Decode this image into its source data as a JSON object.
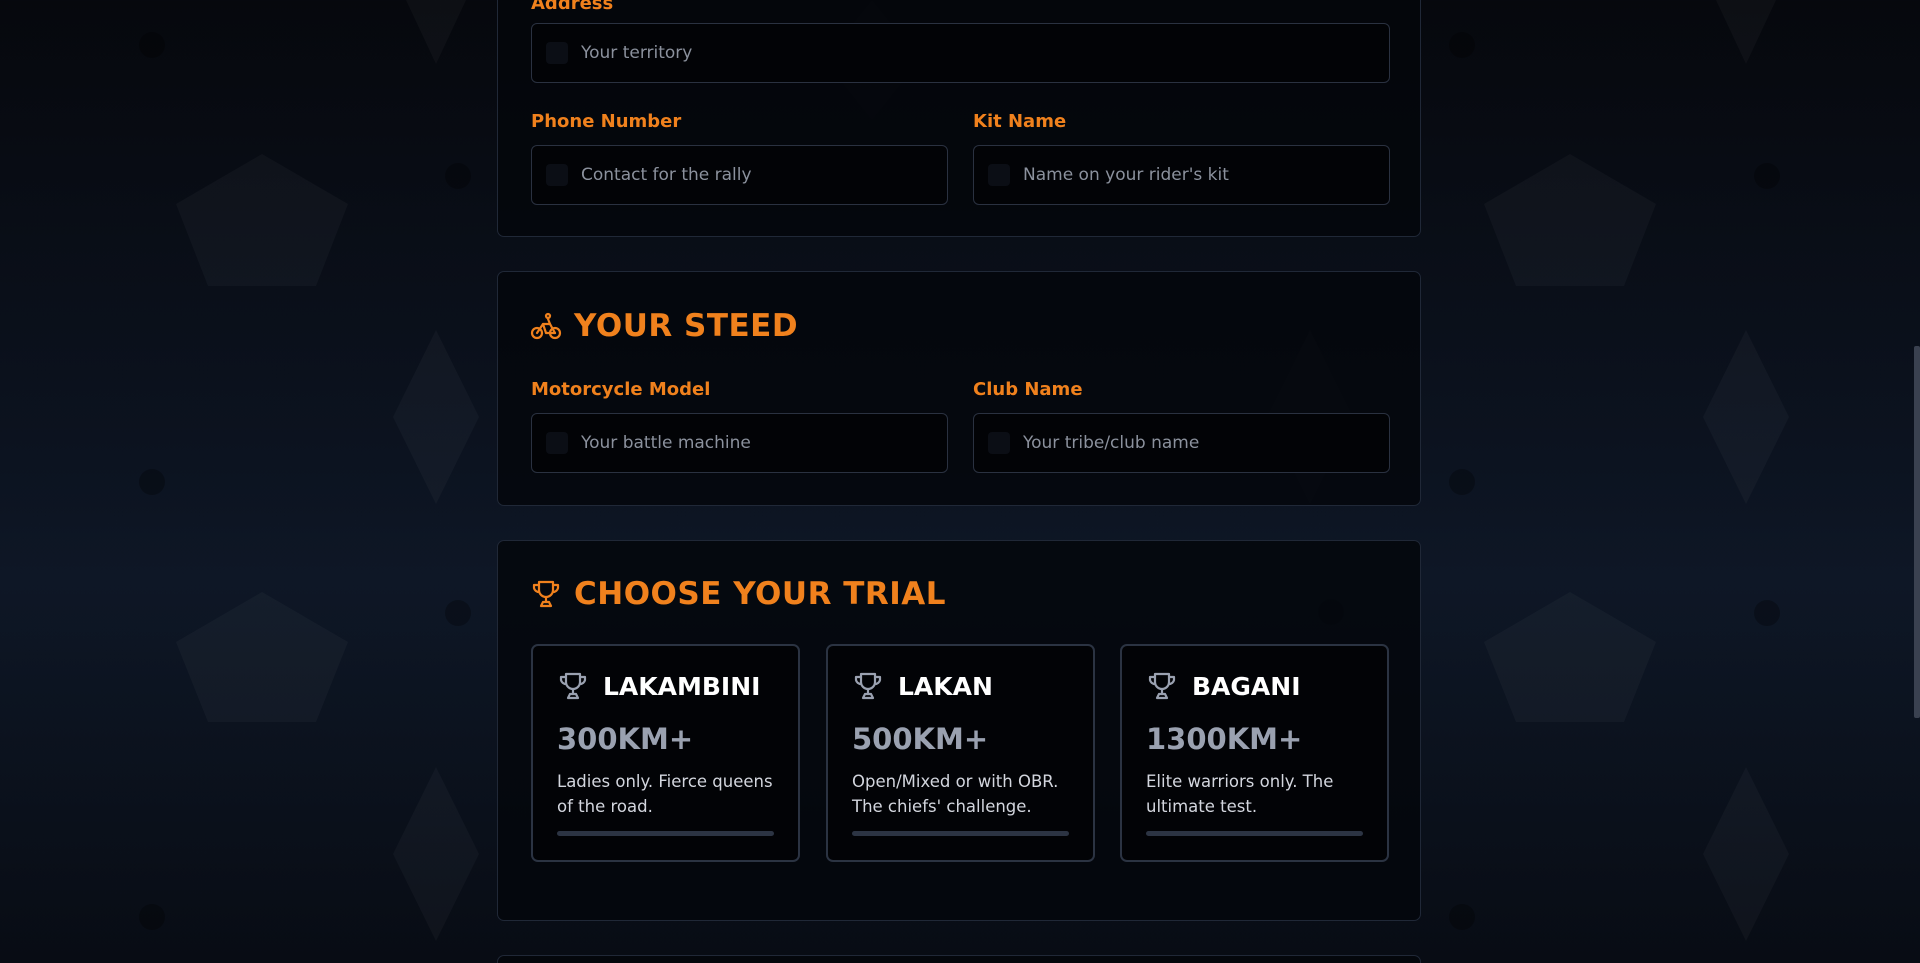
{
  "contact_section": {
    "address_label": "Address",
    "address_placeholder": "Your territory",
    "phone_label": "Phone Number",
    "phone_placeholder": "Contact for the rally",
    "kit_label": "Kit Name",
    "kit_placeholder": "Name on your rider's kit"
  },
  "steed_section": {
    "title": "YOUR STEED",
    "icon": "motorcycle-icon",
    "model_label": "Motorcycle Model",
    "model_placeholder": "Your battle machine",
    "club_label": "Club Name",
    "club_placeholder": "Your tribe/club name"
  },
  "trial_section": {
    "title": "CHOOSE YOUR TRIAL",
    "icon": "trophy-icon",
    "options": [
      {
        "name": "LAKAMBINI",
        "distance": "300KM+",
        "description": "Ladies only. Fierce queens of the road.",
        "selected_fraction": 0
      },
      {
        "name": "LAKAN",
        "distance": "500KM+",
        "description": "Open/Mixed or with OBR. The chiefs' challenge.",
        "selected_fraction": 0
      },
      {
        "name": "BAGANI",
        "distance": "1300KM+",
        "description": "Elite warriors only. The ultimate test.",
        "selected_fraction": 0
      }
    ]
  },
  "colors": {
    "accent": "#f0811d",
    "background": "#0c1320",
    "card": "#04060b",
    "input": "#020306",
    "border": "#2a3140",
    "muted_text": "#9aa1b0"
  }
}
